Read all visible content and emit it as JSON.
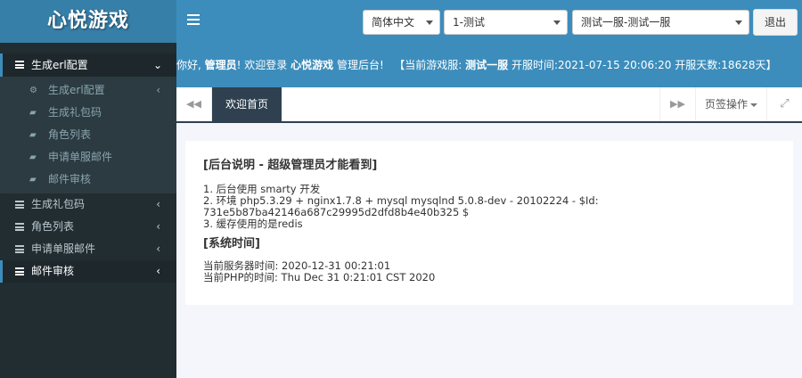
{
  "header": {
    "logo": "心悦游戏",
    "language": "简体中文",
    "server_group": "1-测试",
    "server": "测试一服-测试一服",
    "logout": "退出"
  },
  "infobar": {
    "greeting": "你好,",
    "role": "管理员",
    "welcome_pre": "! 欢迎登录 ",
    "site": "心悦游戏",
    "welcome_post": " 管理后台!",
    "current_label": "【当前游戏服:",
    "current_server": "测试一服",
    "open_label": " 开服时间:",
    "open_time": "2021-07-15 20:06:20",
    "days_label": " 开服天数:",
    "days": "18628天】"
  },
  "sidebar": {
    "items": [
      {
        "label": "生成erl配置",
        "expanded": true
      },
      {
        "label": "生成礼包码"
      },
      {
        "label": "角色列表"
      },
      {
        "label": "申请单服邮件"
      },
      {
        "label": "邮件审核"
      }
    ],
    "subitems": [
      {
        "label": "生成erl配置"
      },
      {
        "label": "生成礼包码"
      },
      {
        "label": "角色列表"
      },
      {
        "label": "申请单服邮件"
      },
      {
        "label": "邮件审核"
      }
    ]
  },
  "tabs": {
    "active": "欢迎首页",
    "ops": "页签操作"
  },
  "panel": {
    "title1": "[后台说明 - 超级管理员才能看到]",
    "lines": [
      "1. 后台使用 smarty 开发",
      "2. 环境 php5.3.29 + nginx1.7.8 + mysql mysqlnd 5.0.8-dev - 20102224 - $Id:",
      "731e5b87ba42146a687c29995d2dfd8b4e40b325 $",
      "3. 缓存使用的是redis"
    ],
    "title2": "[系统时间]",
    "time_lines": [
      "当前服务器时间: 2020-12-31 00:21:01",
      "当前PHP的时间: Thu Dec 31 0:21:01 CST 2020"
    ]
  },
  "colors": {
    "header": "#3c8dbc",
    "logo_bg": "#367fa9",
    "sidebar": "#222d32",
    "submenu": "#2c3b41",
    "tab_active": "#2f4050"
  }
}
